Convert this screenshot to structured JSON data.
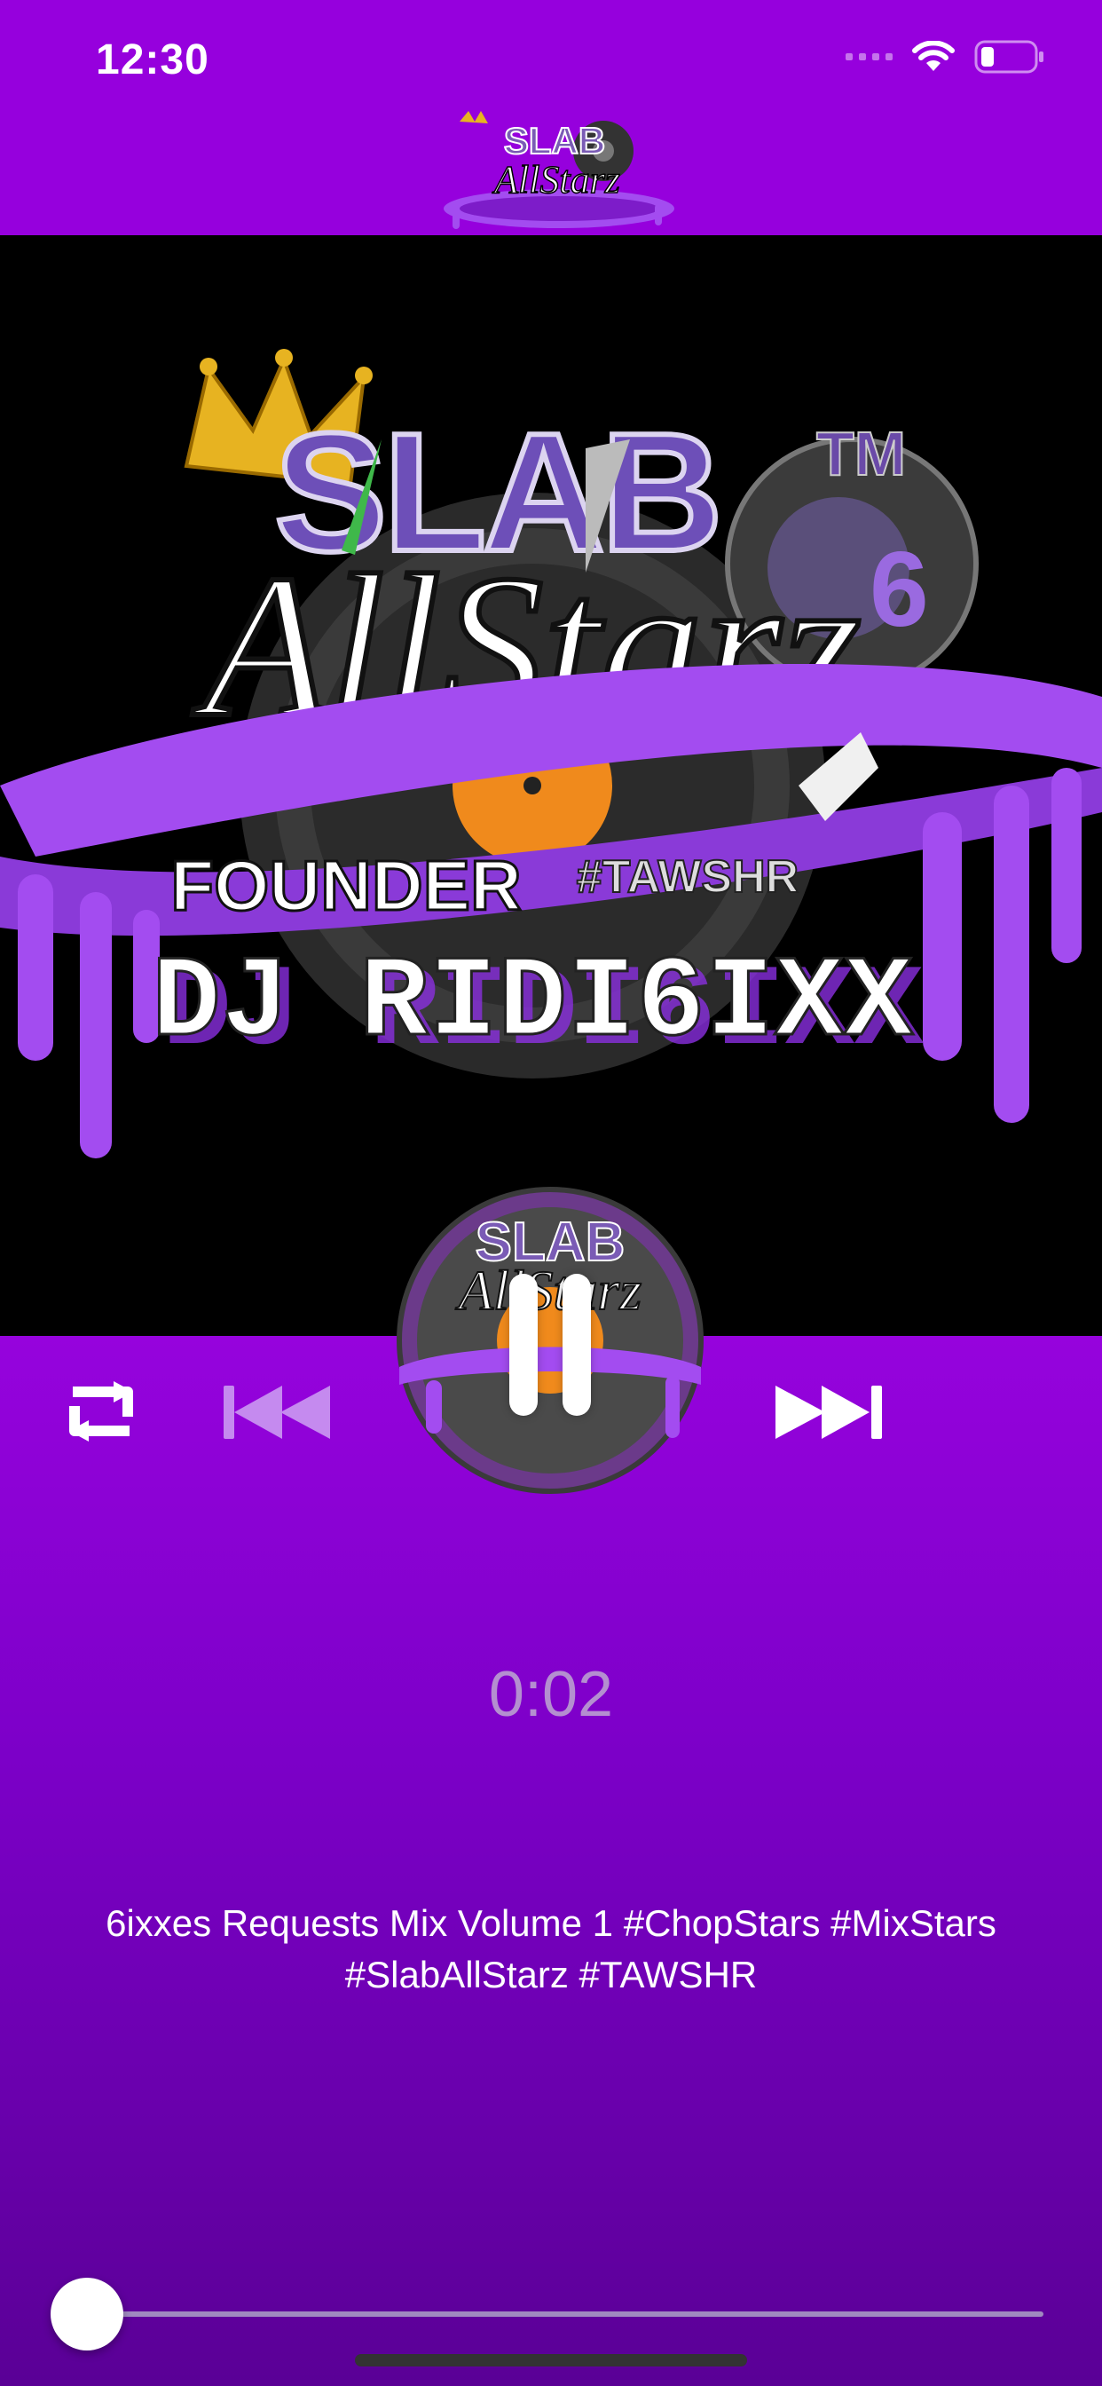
{
  "status_bar": {
    "time": "12:30",
    "icons": [
      "signal-icon",
      "wifi-icon",
      "battery-icon"
    ]
  },
  "header": {
    "logo_text": "SLAB AllStarz"
  },
  "artwork": {
    "brand_top": "SLAB",
    "trademark": "TM",
    "brand_script": "AllStarz",
    "founder_label": "FOUNDER",
    "hashtag": "#TAWSHR",
    "dj_name": "DJ RIDI6IXX"
  },
  "controls": {
    "repeat": "repeat-icon",
    "previous": "previous-track-icon",
    "play_state": "pause-icon",
    "next": "next-track-icon"
  },
  "player": {
    "elapsed": "0:02",
    "track_title": "6ixxes Requests Mix Volume 1 #ChopStars #MixStars #SlabAllStarz #TAWSHR",
    "progress": 0.003
  },
  "colors": {
    "brand_purple": "#9600dd",
    "drip_purple": "#a34cf0",
    "accent_orange": "#f08a1c",
    "crown_gold": "#e7b321"
  }
}
